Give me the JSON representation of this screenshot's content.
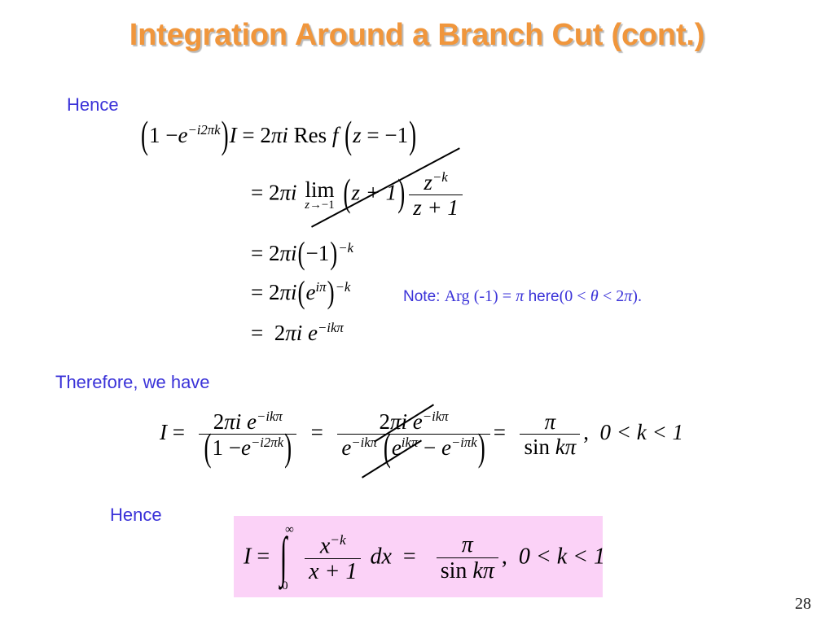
{
  "slide": {
    "title": "Integration Around a Branch Cut (cont.)",
    "page_number": "28",
    "title_color": "#F0963C",
    "label_color": "#3A32D8",
    "result_box_color": "#FBD2F7",
    "math_color": "#000000"
  },
  "labels": {
    "hence_1": "Hence",
    "therefore": "Therefore, we have",
    "hence_2": "Hence"
  },
  "note": {
    "prefix": "Note:",
    "arg": "Arg",
    "arg_value": "(-1) =",
    "pi": "π",
    "here": "here",
    "range_open": "(0 <",
    "theta": "θ",
    "range_close": "< 2",
    "range_pi": "π",
    "range_end": ")."
  },
  "equations": {
    "eq1": {
      "lparen": "(",
      "one_minus": "1 −",
      "e": "e",
      "exp": "−i2πk",
      "rparen": ")",
      "I": "I",
      "equals": "=",
      "two": "2",
      "pi": "π",
      "i": "i",
      "res": "Res",
      "f": "f",
      "arg_lparen": "(",
      "z": "z",
      "arg_equals": "=",
      "minus_one": "−1",
      "arg_rparen": ")"
    },
    "eq2": {
      "equals": "=",
      "two": "2",
      "pi": "π",
      "i": "i",
      "lim": "lim",
      "lim_sub_z": "z",
      "lim_sub_arrow": "→",
      "lim_sub_target": "−1",
      "lparen": "(",
      "z_plus_1": "z + 1",
      "rparen": ")",
      "num_z": "z",
      "num_exp": "−k",
      "den": "z + 1"
    },
    "eq3": {
      "equals": "=",
      "two": "2",
      "pi": "π",
      "i": "i",
      "lparen": "(",
      "minus_one": "−1",
      "rparen": ")",
      "exp": "−k"
    },
    "eq4": {
      "equals": "=",
      "two": "2",
      "pi": "π",
      "i": "i",
      "lparen": "(",
      "e": "e",
      "inner_exp": "iπ",
      "rparen": ")",
      "exp": "−k"
    },
    "eq5": {
      "equals": "=",
      "two": "2",
      "pi": "π",
      "i": "i",
      "e": "e",
      "exp": "−ikπ"
    },
    "eq6": {
      "I": "I",
      "equals_1": "=",
      "f1_num_two": "2",
      "f1_num_pi": "π",
      "f1_num_i": "i",
      "f1_num_e": "e",
      "f1_num_exp": "−ikπ",
      "f1_den_lparen": "(",
      "f1_den_one_minus": "1 −",
      "f1_den_e": "e",
      "f1_den_exp": "−i2πk",
      "f1_den_rparen": ")",
      "equals_2": "=",
      "f2_num_two": "2",
      "f2_num_pi": "π",
      "f2_num_i": "i",
      "f2_num_e": "e",
      "f2_num_exp": "−ikπ",
      "f2_den_e": "e",
      "f2_den_exp": "−ikπ",
      "f2_den_lparen": "(",
      "f2_den_e1": "e",
      "f2_den_exp1": "ikπ",
      "f2_den_minus": "−",
      "f2_den_e2": "e",
      "f2_den_exp2": "−iπk",
      "f2_den_rparen": ")",
      "equals_3": "=",
      "f3_num_pi": "π",
      "f3_den_sin": "sin",
      "f3_den_k": "k",
      "f3_den_pi": "π",
      "comma": ",",
      "condition": "0 < k < 1"
    },
    "eq_final": {
      "I": "I",
      "equals_1": "=",
      "int_upper": "∞",
      "int_lower": "0",
      "int_glyph": "∫",
      "num_x": "x",
      "num_exp": "−k",
      "den": "x + 1",
      "dx": "dx",
      "equals_2": "=",
      "res_num_pi": "π",
      "res_den_sin": "sin",
      "res_den_k": "k",
      "res_den_pi": "π",
      "comma": ",",
      "condition": "0 < k < 1"
    }
  }
}
